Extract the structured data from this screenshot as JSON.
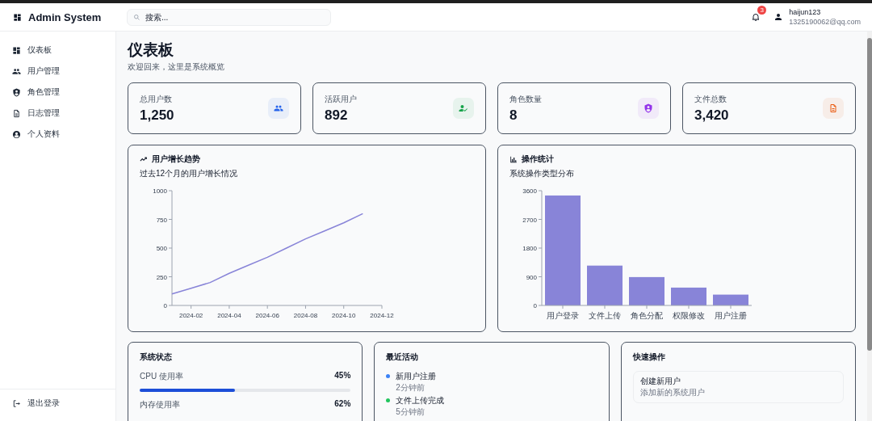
{
  "app": {
    "title": "Admin System"
  },
  "search": {
    "placeholder": "搜索..."
  },
  "header": {
    "notification_count": "3",
    "user_name": "haijun123",
    "user_email": "1325190062@qq.com"
  },
  "sidebar": {
    "items": [
      {
        "label": "仪表板"
      },
      {
        "label": "用户管理"
      },
      {
        "label": "角色管理"
      },
      {
        "label": "日志管理"
      },
      {
        "label": "个人资料"
      }
    ],
    "logout": "退出登录"
  },
  "page": {
    "title": "仪表板",
    "subtitle": "欢迎回来，这里是系统概览"
  },
  "stats": [
    {
      "label": "总用户数",
      "value": "1,250",
      "color": "#2563eb"
    },
    {
      "label": "活跃用户",
      "value": "892",
      "color": "#16a34a"
    },
    {
      "label": "角色数量",
      "value": "8",
      "color": "#9333ea"
    },
    {
      "label": "文件总数",
      "value": "3,420",
      "color": "#ea580c"
    }
  ],
  "growth_chart": {
    "title": "用户增长趋势",
    "subtitle": "过去12个月的用户增长情况",
    "chart_data": {
      "type": "line",
      "categories": [
        null,
        "2024-02",
        null,
        "2024-04",
        null,
        "2024-06",
        null,
        "2024-08",
        null,
        "2024-10",
        null,
        "2024-12"
      ],
      "ylim": [
        0,
        1000
      ],
      "yticks": [
        0,
        250,
        500,
        750,
        1000
      ],
      "series": [
        {
          "color": "#8884d8",
          "values": [
            100,
            150,
            200,
            280,
            350,
            420,
            500,
            580,
            650,
            720,
            800,
            null
          ]
        }
      ]
    }
  },
  "ops_chart": {
    "title": "操作统计",
    "subtitle": "系统操作类型分布",
    "chart_data": {
      "type": "bar",
      "categories": [
        "用户登录",
        "文件上传",
        "角色分配",
        "权限修改",
        "用户注册"
      ],
      "ylim": [
        0,
        3600
      ],
      "yticks": [
        0,
        900,
        1800,
        2700,
        3600
      ],
      "series": [
        {
          "color": "#8884d8",
          "values": [
            3450,
            1250,
            890,
            560,
            340
          ]
        }
      ]
    }
  },
  "system_status": {
    "title": "系统状态",
    "metrics": [
      {
        "label": "CPU 使用率",
        "reading": "45%",
        "level": 0.45
      },
      {
        "label": "内存使用率",
        "reading": "62%"
      }
    ]
  },
  "recent_activity": {
    "title": "最近活动",
    "items": [
      {
        "text": "新用户注册",
        "time": "2分钟前",
        "color": "#3b82f6"
      },
      {
        "text": "文件上传完成",
        "time": "5分钟前",
        "color": "#22c55e"
      }
    ]
  },
  "quick_actions": {
    "title": "快速操作",
    "items": [
      {
        "title": "创建新用户",
        "description": "添加新的系统用户"
      }
    ]
  }
}
